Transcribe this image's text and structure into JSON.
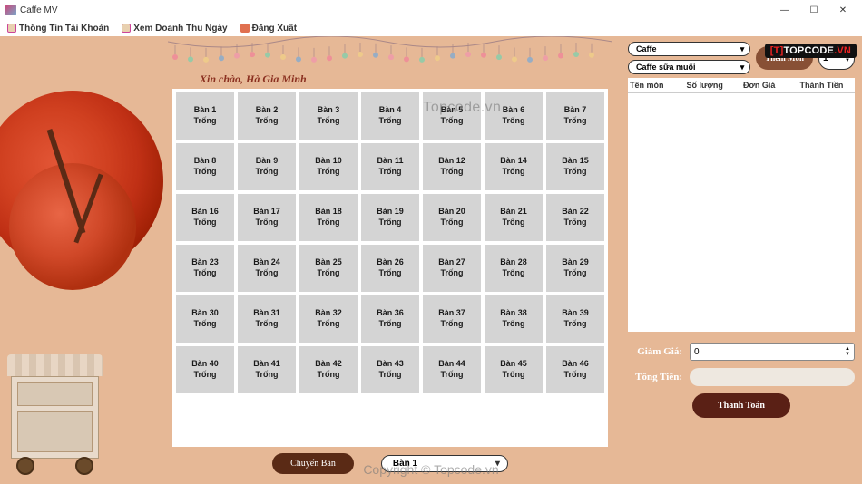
{
  "window": {
    "title": "Caffe MV"
  },
  "menu": {
    "account": "Thông Tin Tài Khoản",
    "revenue": "Xem Doanh Thu Ngày",
    "logout": "Đăng Xuất"
  },
  "greeting": "Xin chào, Hà Gia Minh",
  "tables": [
    {
      "name": "Bàn 1",
      "status": "Trống"
    },
    {
      "name": "Bàn 2",
      "status": "Trống"
    },
    {
      "name": "Bàn 3",
      "status": "Trống"
    },
    {
      "name": "Bàn 4",
      "status": "Trống"
    },
    {
      "name": "Bàn 5",
      "status": "Trống"
    },
    {
      "name": "Bàn 6",
      "status": "Trống"
    },
    {
      "name": "Bàn 7",
      "status": "Trống"
    },
    {
      "name": "Bàn 8",
      "status": "Trống"
    },
    {
      "name": "Bàn 9",
      "status": "Trống"
    },
    {
      "name": "Bàn 10",
      "status": "Trống"
    },
    {
      "name": "Bàn 11",
      "status": "Trống"
    },
    {
      "name": "Bàn 12",
      "status": "Trống"
    },
    {
      "name": "Bàn 14",
      "status": "Trống"
    },
    {
      "name": "Bàn 15",
      "status": "Trống"
    },
    {
      "name": "Bàn 16",
      "status": "Trống"
    },
    {
      "name": "Bàn 17",
      "status": "Trống"
    },
    {
      "name": "Bàn 18",
      "status": "Trống"
    },
    {
      "name": "Bàn 19",
      "status": "Trống"
    },
    {
      "name": "Bàn 20",
      "status": "Trống"
    },
    {
      "name": "Bàn 21",
      "status": "Trống"
    },
    {
      "name": "Bàn 22",
      "status": "Trống"
    },
    {
      "name": "Bàn 23",
      "status": "Trống"
    },
    {
      "name": "Bàn 24",
      "status": "Trống"
    },
    {
      "name": "Bàn 25",
      "status": "Trống"
    },
    {
      "name": "Bàn 26",
      "status": "Trống"
    },
    {
      "name": "Bàn 27",
      "status": "Trống"
    },
    {
      "name": "Bàn 28",
      "status": "Trống"
    },
    {
      "name": "Bàn 29",
      "status": "Trống"
    },
    {
      "name": "Bàn 30",
      "status": "Trống"
    },
    {
      "name": "Bàn 31",
      "status": "Trống"
    },
    {
      "name": "Bàn 32",
      "status": "Trống"
    },
    {
      "name": "Bàn 36",
      "status": "Trống"
    },
    {
      "name": "Bàn 37",
      "status": "Trống"
    },
    {
      "name": "Bàn 38",
      "status": "Trống"
    },
    {
      "name": "Bàn 39",
      "status": "Trống"
    },
    {
      "name": "Bàn 40",
      "status": "Trống"
    },
    {
      "name": "Bàn 41",
      "status": "Trống"
    },
    {
      "name": "Bàn 42",
      "status": "Trống"
    },
    {
      "name": "Bàn 43",
      "status": "Trống"
    },
    {
      "name": "Bàn 44",
      "status": "Trống"
    },
    {
      "name": "Bàn 45",
      "status": "Trống"
    },
    {
      "name": "Bàn 46",
      "status": "Trống"
    }
  ],
  "bottom": {
    "move_table": "Chuyển Bàn",
    "table_select": "Bàn 1"
  },
  "right": {
    "category_select": "Caffe",
    "item_select": "Caffe sữa muối",
    "add_btn": "Thêm Món",
    "qty": "1",
    "columns": [
      "Tên món",
      "Số lượng",
      "Đơn Giá",
      "Thành Tiền"
    ],
    "discount_label": "Giảm Giá:",
    "discount_value": "0",
    "total_label": "Tổng Tiền:",
    "pay_btn": "Thanh Toán"
  },
  "watermark": {
    "brand_prefix": "[T]",
    "brand_main": "TOPCODE",
    "brand_suffix": ".VN",
    "center": "Topcode.vn",
    "bottom": "Copyright © Topcode.vn"
  }
}
